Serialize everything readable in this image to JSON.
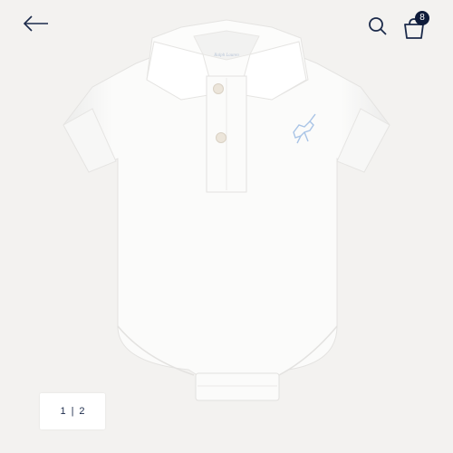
{
  "header": {
    "bag_count": "8"
  },
  "product": {
    "label_text": "Ralph Lauren"
  },
  "pager": {
    "pages": [
      "1",
      "2"
    ],
    "separator": "|"
  },
  "colors": {
    "background": "#f3f2f0",
    "garment": "#ffffff",
    "navy": "#0e1b3a",
    "logo_blue": "#a9c4e6"
  },
  "icons": {
    "back": "arrow-left-icon",
    "search": "search-icon",
    "bag": "shopping-bag-icon",
    "logo": "polo-pony-logo-icon"
  }
}
